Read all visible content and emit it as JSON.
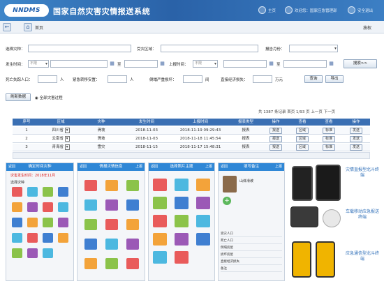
{
  "header": {
    "logo": "NNDMS",
    "title": "国家自然灾害灾情报送系统",
    "home": "主页",
    "welcome": "欢迎您：国家应急管理部",
    "logout": "安全退出"
  },
  "nav": {
    "home_label": "首页",
    "right_label": "按权"
  },
  "form": {
    "disaster_type": "选择灾种：",
    "disaster_area": "受灾区域：",
    "report_month": "报告月份：",
    "occur_time": "发生时间：",
    "no_limit": "不限",
    "to": "至",
    "report_time": "上报时间：",
    "search": "搜索>>",
    "deaths": "死亡失踪人口：",
    "person": "人",
    "relocated": "紧急转移安置：",
    "collapsed": "倒塌严重损坏：",
    "room": "间",
    "direct_loss": "直接经济损失：",
    "wan_yuan": "万元",
    "query": "查询",
    "export": "导出",
    "refresh": "刷新数据",
    "all_process": "全部灾害过程"
  },
  "pager": {
    "text": "共 1387 条记录 首页 1/93 页 上一页 下一页"
  },
  "table": {
    "headers": [
      "序号",
      "区域",
      "灾种",
      "发生时间",
      "上报时间",
      "报表类型",
      "操作",
      "查看",
      "查看",
      "操作"
    ],
    "rows": [
      {
        "no": "1",
        "area": "四川省",
        "type": "滑坡",
        "occur": "2018-11-03",
        "report": "2018-11-19 09:29:43",
        "form": "报表",
        "op1": "报送",
        "v1": "区域",
        "v2": "标准",
        "op2": "发送"
      },
      {
        "no": "2",
        "area": "云南省",
        "type": "滑坡",
        "occur": "2018-11-03",
        "report": "2018-11-18 11:45:54",
        "form": "报表",
        "op1": "报送",
        "v1": "区域",
        "v2": "标准",
        "op2": "发送"
      },
      {
        "no": "3",
        "area": "青海省",
        "type": "雪灾",
        "occur": "2018-11-15",
        "report": "2018-11-17 15:48:31",
        "form": "报表",
        "op1": "报送",
        "v1": "区域",
        "v2": "标准",
        "op2": "发送"
      }
    ]
  },
  "phones": {
    "p1": {
      "title": "确定时间灾种",
      "back": "返回",
      "tip": "灾害发生时间：2018年11月",
      "section": "选择灾种"
    },
    "p2": {
      "title": "情报灾情信息",
      "back": "返回",
      "action": "上报"
    },
    "p3": {
      "title": "选择照片主题",
      "back": "返回",
      "action": "上报"
    },
    "p4": {
      "title": "填写备注",
      "back": "返回",
      "action": "上报",
      "name": "山体滑坡",
      "rows": [
        "受灾人口",
        "死亡人口",
        "倒塌房屋",
        "损坏房屋",
        "直接经济损失",
        "备注"
      ]
    }
  },
  "devices": {
    "d1": "灾情直报型北斗终端",
    "d2": "车载移动应急报送终端",
    "d3": "应急通信型北斗终端"
  },
  "colors": {
    "header": "#2a62a8",
    "table_header": "#3a6fb3",
    "phone_bar": "#2f87d6"
  }
}
